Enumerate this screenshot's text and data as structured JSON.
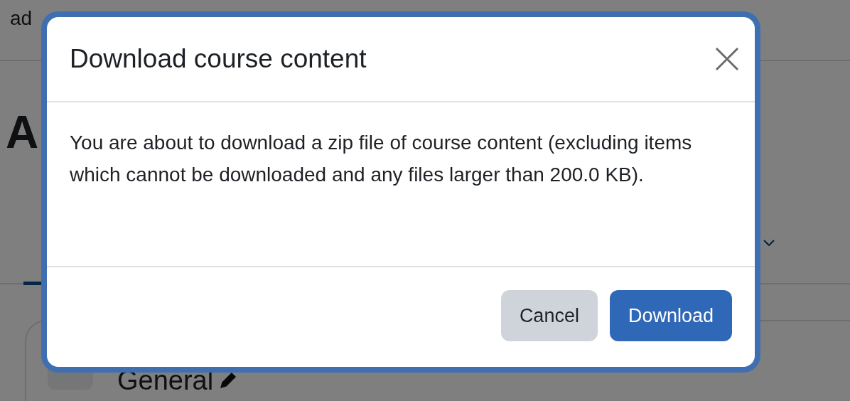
{
  "background": {
    "breadcrumb": "ad",
    "heading": "A",
    "section_title": "General"
  },
  "dialog": {
    "title": "Download course content",
    "message": "You are about to download a zip file of course content (excluding items which cannot be downloaded and any files larger than 200.0 KB).",
    "buttons": [
      {
        "label": "Cancel",
        "kind": "secondary"
      },
      {
        "label": "Download",
        "kind": "primary"
      }
    ]
  }
}
